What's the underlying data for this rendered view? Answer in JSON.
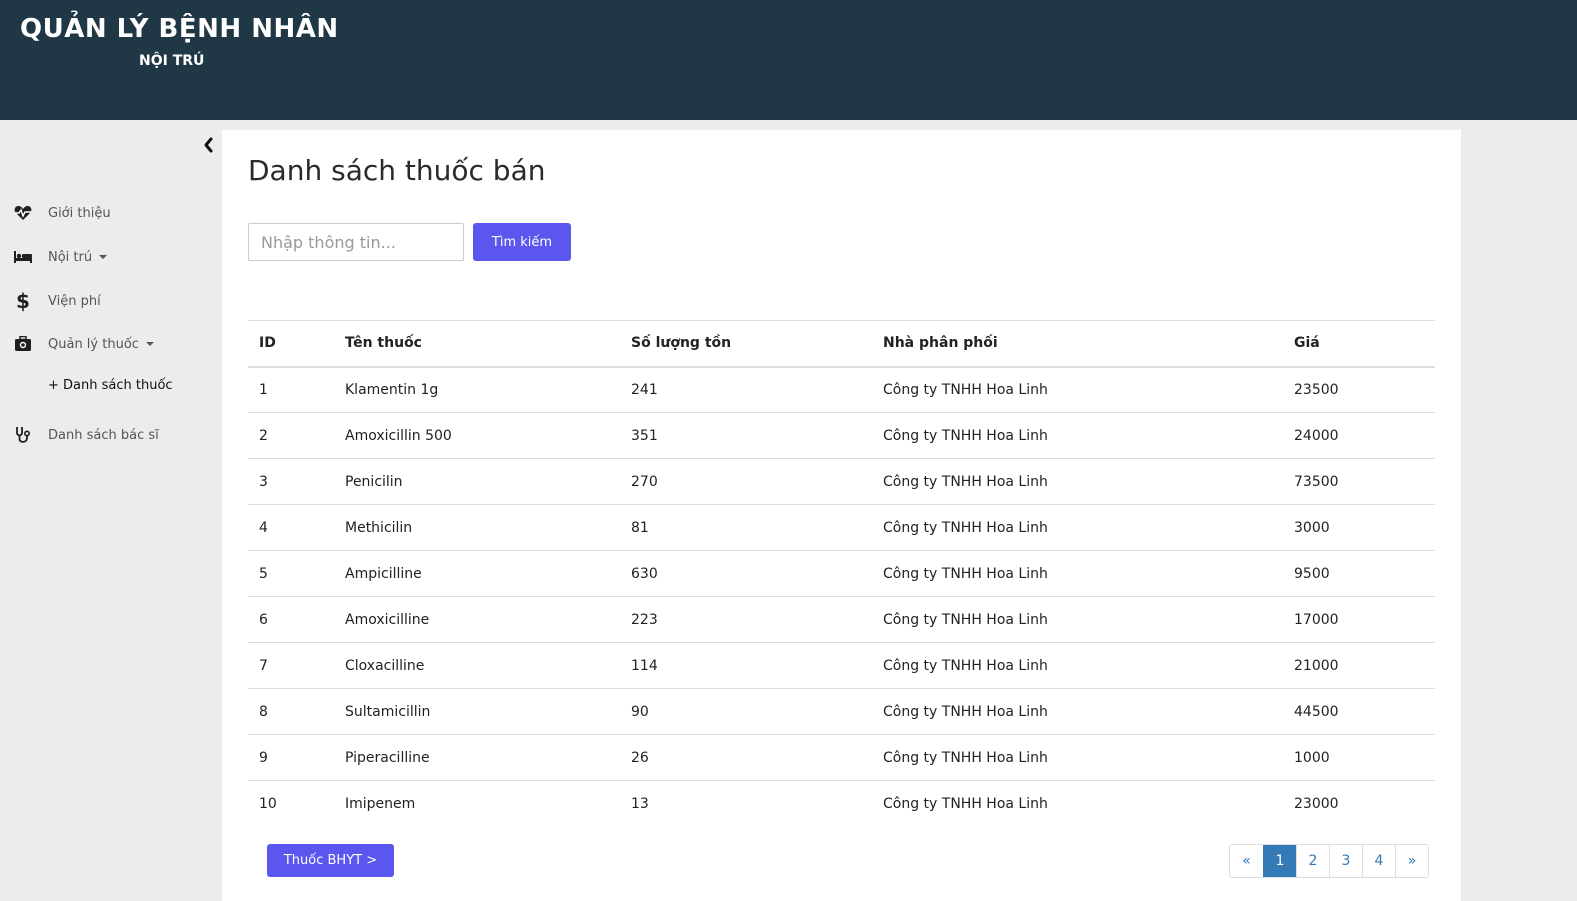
{
  "app": {
    "title": "QUẢN LÝ BỆNH NHÂN",
    "subtitle": "NỘI TRÚ"
  },
  "sidebar": {
    "items": [
      {
        "label": "Giới thiệu",
        "icon": "heartbeat-icon"
      },
      {
        "label": "Nội trú",
        "icon": "bed-icon",
        "dropdown": true
      },
      {
        "label": "Viện phí",
        "icon": "dollar-icon"
      },
      {
        "label": "Quản lý thuốc",
        "icon": "medkit-icon",
        "dropdown": true
      },
      {
        "label": "Danh sách bác sĩ",
        "icon": "stethoscope-icon"
      }
    ],
    "sub_item": "+ Danh sách thuốc"
  },
  "page": {
    "title": "Danh sách thuốc bán"
  },
  "search": {
    "placeholder": "Nhập thông tin...",
    "value": "",
    "button": "Tìm kiếm"
  },
  "table": {
    "headers": [
      "ID",
      "Tên thuốc",
      "Số lượng tồn",
      "Nhà phân phối",
      "Giá"
    ],
    "rows": [
      [
        "1",
        "Klamentin 1g",
        "241",
        "Công ty TNHH Hoa Linh",
        "23500"
      ],
      [
        "2",
        "Amoxicillin 500",
        "351",
        "Công ty TNHH Hoa Linh",
        "24000"
      ],
      [
        "3",
        "Penicilin",
        "270",
        "Công ty TNHH Hoa Linh",
        "73500"
      ],
      [
        "4",
        "Methicilin",
        "81",
        "Công ty TNHH Hoa Linh",
        "3000"
      ],
      [
        "5",
        "Ampicilline",
        "630",
        "Công ty TNHH Hoa Linh",
        "9500"
      ],
      [
        "6",
        "Amoxicilline",
        "223",
        "Công ty TNHH Hoa Linh",
        "17000"
      ],
      [
        "7",
        "Cloxacilline",
        "114",
        "Công ty TNHH Hoa Linh",
        "21000"
      ],
      [
        "8",
        "Sultamicillin",
        "90",
        "Công ty TNHH Hoa Linh",
        "44500"
      ],
      [
        "9",
        "Piperacilline",
        "26",
        "Công ty TNHH Hoa Linh",
        "1000"
      ],
      [
        "10",
        "Imipenem",
        "13",
        "Công ty TNHH Hoa Linh",
        "23000"
      ]
    ]
  },
  "footer": {
    "bhyt_button": "Thuốc BHYT >"
  },
  "pagination": {
    "prev": "«",
    "pages": [
      "1",
      "2",
      "3",
      "4"
    ],
    "active": "1",
    "next": "»"
  },
  "colors": {
    "header_bg": "#203845",
    "accent": "#5b57ee",
    "pagination_active": "#337ab7"
  }
}
